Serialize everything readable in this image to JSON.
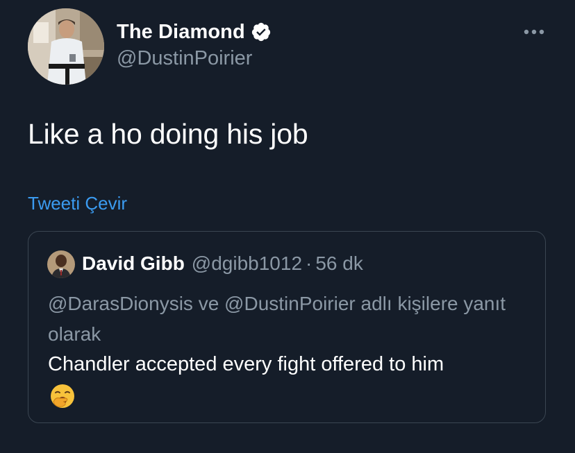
{
  "author": {
    "display_name": "The Diamond",
    "handle": "@DustinPoirier",
    "verified": true,
    "avatar": "profile-photo-avatar"
  },
  "tweet": {
    "text": "Like a ho doing his job",
    "translate_label": "Tweeti Çevir"
  },
  "more_icon": "more-horizontal-icon",
  "quoted_tweet": {
    "author_name": "David Gibb",
    "author_handle": "@dgibb1012",
    "separator": "·",
    "time": "56 dk",
    "reply_context": "@DarasDionysis ve @DustinPoirier adlı kişilere yanıt olarak",
    "text": "Chandler accepted every fight offered to him",
    "emoji": "yawning-face-emoji"
  },
  "colors": {
    "background": "#151d29",
    "text_primary": "#ffffff",
    "text_secondary": "#8b98a5",
    "link": "#3b9bf0",
    "border": "#3b4652",
    "verified_badge": "#ffffff"
  }
}
